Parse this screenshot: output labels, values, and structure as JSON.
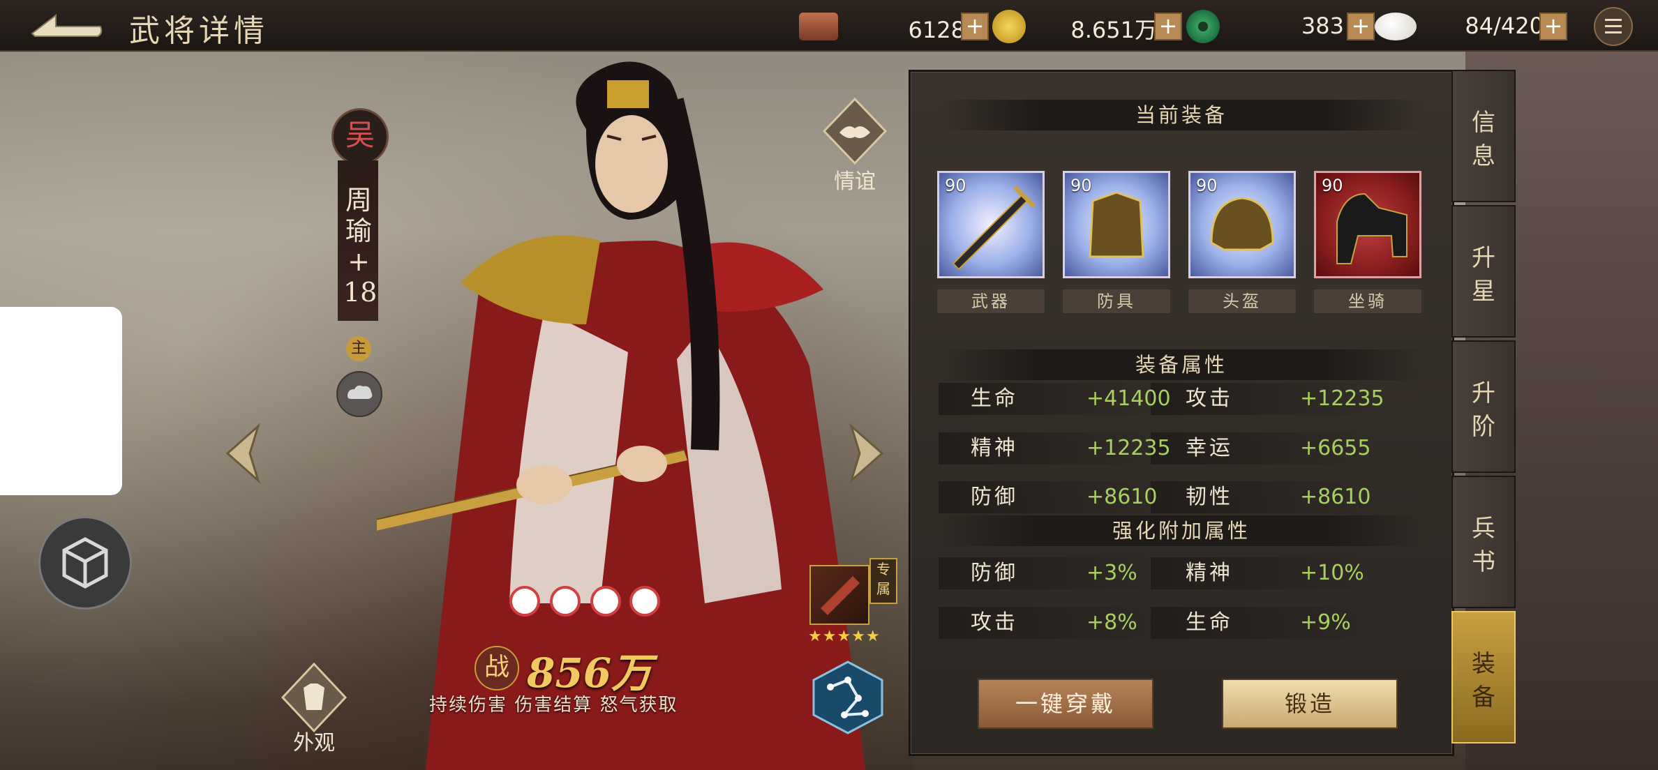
{
  "header": {
    "title": "武将详情",
    "resources": [
      {
        "icon": "copper-coin-stack-icon",
        "value": "6128万"
      },
      {
        "icon": "gold-coin-icon",
        "value": "8.651万"
      },
      {
        "icon": "jade-icon",
        "value": "383"
      },
      {
        "icon": "steamed-bun-icon",
        "value": "84/420"
      }
    ],
    "plus_label": "+"
  },
  "general": {
    "faction": "吴",
    "name_chars": [
      "周",
      "瑜",
      "+",
      "18"
    ],
    "main_badge": "主",
    "power": "856万",
    "power_badge": "战",
    "skills": "持续伤害  伤害结算  怒气获取",
    "exclusive_tag": "专属",
    "exclusive_stars": "★★★★★"
  },
  "side_buttons": {
    "friendship": "情谊",
    "appearance": "外观"
  },
  "equipment": {
    "current_title": "当前装备",
    "slots": [
      {
        "level": "90",
        "name": "武器"
      },
      {
        "level": "90",
        "name": "防具"
      },
      {
        "level": "90",
        "name": "头盔"
      },
      {
        "level": "90",
        "name": "坐骑"
      }
    ],
    "attr_title": "装备属性",
    "attrs": [
      {
        "label": "生命",
        "value": "+41400",
        "label2": "攻击",
        "value2": "+12235"
      },
      {
        "label": "精神",
        "value": "+12235",
        "label2": "幸运",
        "value2": "+6655"
      },
      {
        "label": "防御",
        "value": "+8610",
        "label2": "韧性",
        "value2": "+8610"
      }
    ],
    "bonus_title": "强化附加属性",
    "bonus": [
      {
        "label": "防御",
        "value": "+3%",
        "label2": "精神",
        "value2": "+10%"
      },
      {
        "label": "攻击",
        "value": "+8%",
        "label2": "生命",
        "value2": "+9%"
      }
    ],
    "wear_button": "一键穿戴",
    "forge_button": "锻造"
  },
  "tabs": [
    {
      "label": "信息",
      "active": false
    },
    {
      "label": "升星",
      "active": false
    },
    {
      "label": "升阶",
      "active": false
    },
    {
      "label": "兵书",
      "active": false
    },
    {
      "label": "装备",
      "active": true
    }
  ],
  "colors": {
    "stat_value": "#a8d060",
    "active_tab": "#c8a040"
  }
}
